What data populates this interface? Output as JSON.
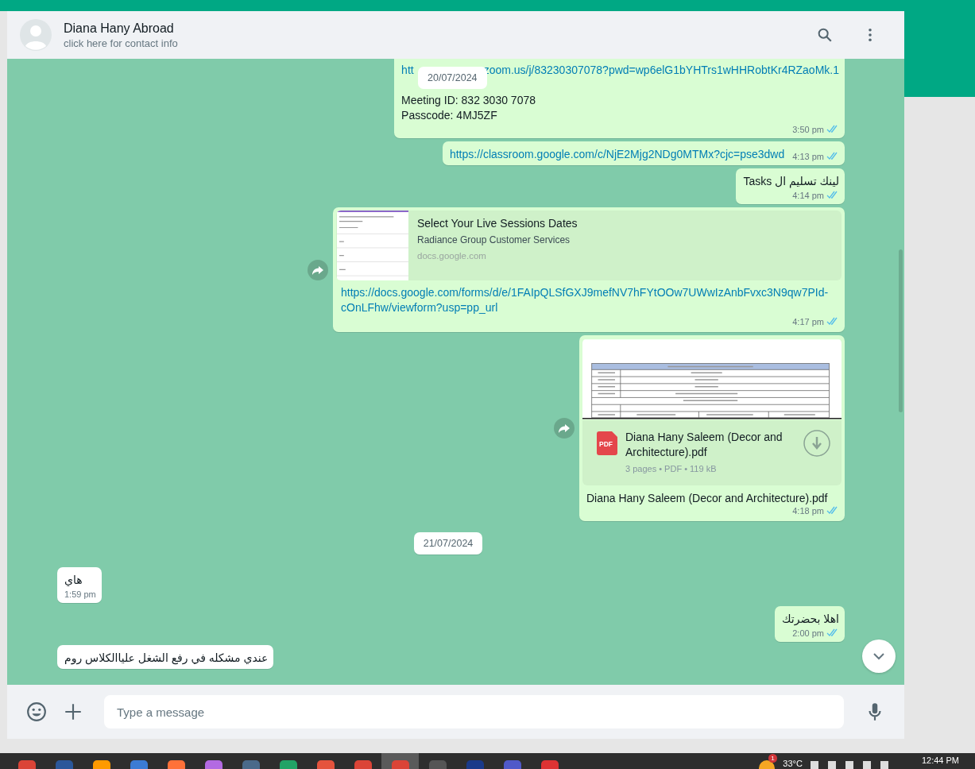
{
  "header": {
    "name": "Diana Hany Abroad",
    "subtitle": "click here for contact info"
  },
  "sticky_date": "20/07/2024",
  "messages": [
    {
      "kind": "text",
      "incoming": false,
      "lines": [
        {
          "link": true,
          "parts": [
            "htt",
            "zoom.us/j/83230307078?pwd=wp6elG1bYHTrs1wHHRobtKr4RZaoMk.1"
          ]
        },
        {
          "link": false,
          "parts": [
            "Meeting ID: 832 3030 7078"
          ]
        },
        {
          "link": false,
          "parts": [
            "Passcode: 4MJ5ZF"
          ]
        }
      ],
      "time": "3:50 pm",
      "read": true
    },
    {
      "kind": "text",
      "incoming": false,
      "lines": [
        {
          "link": true,
          "parts": [
            "https://classroom.google.com/c/NjE2Mjg2NDg0MTMx?cjc=pse3dwd"
          ]
        }
      ],
      "time": "4:13 pm",
      "read": true
    },
    {
      "kind": "text",
      "incoming": false,
      "lines": [
        {
          "link": false,
          "parts": [
            "لينك تسليم ال Tasks"
          ]
        }
      ],
      "time": "4:14 pm",
      "read": true
    },
    {
      "kind": "link_preview",
      "incoming": false,
      "forward": true,
      "title": "Select Your Live Sessions Dates",
      "subtitle": "Radiance Group Customer Services",
      "domain": "docs.google.com",
      "url": "https://docs.google.com/forms/d/e/1FAIpQLSfGXJ9mefNV7hFYtOOw7UWwIzAnbFvxc3N9qw7PId-cOnLFhw/viewform?usp=pp_url",
      "time": "4:17 pm",
      "read": true
    },
    {
      "kind": "document",
      "incoming": false,
      "forward": true,
      "file_name": "Diana Hany Saleem (Decor and Architecture).pdf",
      "file_type": "PDF",
      "file_info": "3 pages • PDF • 119 kB",
      "caption": "Diana Hany Saleem (Decor and Architecture).pdf",
      "time": "4:18 pm",
      "read": true
    },
    {
      "kind": "date",
      "text": "21/07/2024"
    },
    {
      "kind": "text",
      "incoming": true,
      "lines": [
        {
          "link": false,
          "parts": [
            "هاي"
          ]
        }
      ],
      "time": "1:59 pm"
    },
    {
      "kind": "text",
      "incoming": false,
      "lines": [
        {
          "link": false,
          "parts": [
            "اهلا بحضرتك"
          ]
        }
      ],
      "time": "2:00 pm",
      "read": true
    },
    {
      "kind": "text",
      "incoming": true,
      "lines": [
        {
          "link": false,
          "parts": [
            "عندي مشكله في رفع الشغل علياالكلاس روم"
          ]
        }
      ]
    }
  ],
  "composer": {
    "placeholder": "Type a message"
  },
  "taskbar": {
    "apps": [
      {
        "selected": false
      },
      {
        "selected": false
      },
      {
        "selected": false
      },
      {
        "selected": false
      },
      {
        "selected": false
      },
      {
        "selected": false
      },
      {
        "selected": false
      },
      {
        "selected": false
      },
      {
        "selected": false
      },
      {
        "selected": false
      },
      {
        "selected": true
      },
      {
        "selected": false
      },
      {
        "selected": false
      },
      {
        "selected": false
      },
      {
        "selected": false
      }
    ],
    "weather_badge": "1",
    "temperature": "33°C",
    "clock": "12:44 PM"
  }
}
